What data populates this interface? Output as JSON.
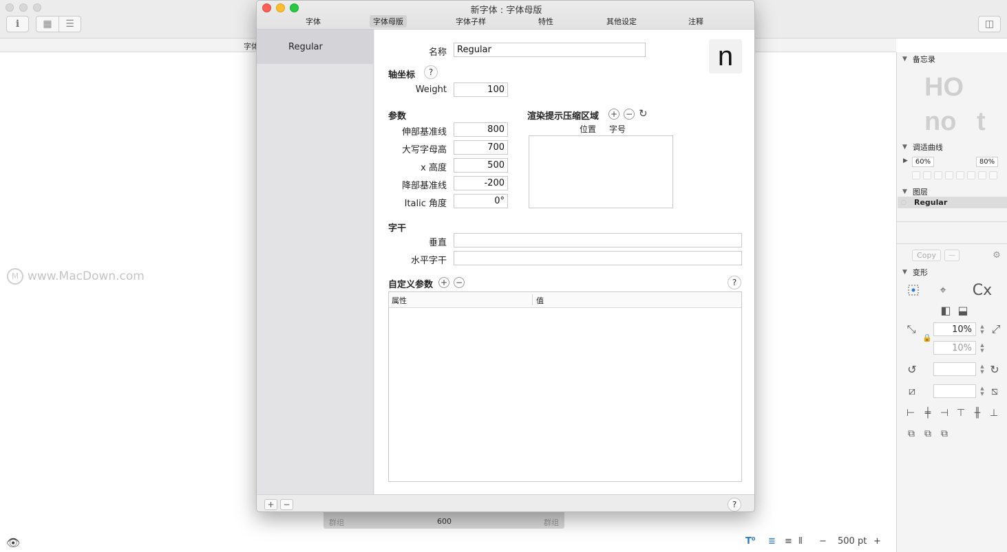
{
  "background": {
    "tab_label": "字体",
    "watermark": "www.MacDown.com",
    "group_left": "群组",
    "group_center": "600",
    "group_right": "群组",
    "zoom_value": "500 pt"
  },
  "sidebar": {
    "memo_title": "备忘录",
    "curve_title": "调适曲线",
    "curve_left_pct": "60%",
    "curve_right_pct": "80%",
    "layers_title": "图层",
    "layer_name": "Regular",
    "copy_label": "Copy",
    "transform_title": "变形",
    "scale_x": "10%",
    "scale_y": "10%"
  },
  "dialog": {
    "title": "新字体 : 字体母版",
    "tabs": [
      {
        "label": "字体",
        "active": false
      },
      {
        "label": "字体母版",
        "active": true
      },
      {
        "label": "字体子样",
        "active": false
      },
      {
        "label": "特性",
        "active": false
      },
      {
        "label": "其他设定",
        "active": false
      },
      {
        "label": "注释",
        "active": false
      }
    ],
    "masters": [
      "Regular"
    ],
    "name_label": "名称",
    "name_value": "Regular",
    "preview_glyph": "n",
    "axes_title": "轴坐标",
    "axes": [
      {
        "label": "Weight",
        "value": "100"
      }
    ],
    "params_title": "参数",
    "params": [
      {
        "label": "伸部基准线",
        "value": "800"
      },
      {
        "label": "大写字母高",
        "value": "700"
      },
      {
        "label": "x 高度",
        "value": "500"
      },
      {
        "label": "降部基准线",
        "value": "-200"
      },
      {
        "label": "Italic 角度",
        "value": "0°"
      }
    ],
    "hint_title": "渲染提示压缩区域",
    "hint_col_position": "位置",
    "hint_col_size": "字号",
    "stems_title": "字干",
    "stem_vertical_label": "垂直",
    "stem_vertical_value": "",
    "stem_horizontal_label": "水平字干",
    "stem_horizontal_value": "",
    "custom_title": "自定义参数",
    "col_property": "属性",
    "col_value": "值",
    "help_glyph": "?"
  }
}
